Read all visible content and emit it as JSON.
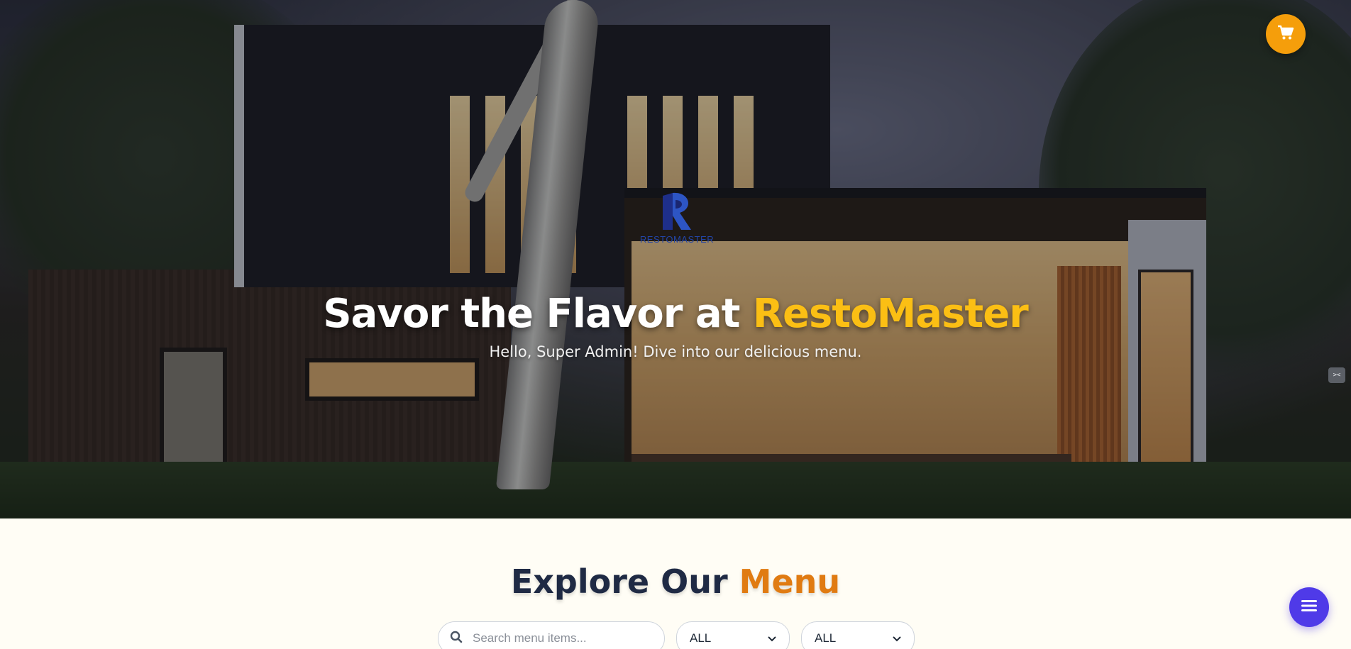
{
  "brand": {
    "logo_text": "RESTOMASTER"
  },
  "hero": {
    "title_prefix": "Savor the Flavor at ",
    "title_accent": "RestoMaster",
    "subtitle": "Hello, Super Admin! Dive into our delicious menu."
  },
  "menu": {
    "title_prefix": "Explore Our ",
    "title_accent": "Menu",
    "search_placeholder": "Search menu items...",
    "filter_one_value": "ALL",
    "filter_two_value": "ALL"
  },
  "icons": {
    "cart": "cart-icon",
    "search": "search-icon",
    "menu": "hamburger-icon",
    "side_handle": "code-icon"
  },
  "colors": {
    "accent_yellow": "#fbbf14",
    "accent_orange": "#e07b12",
    "cart_button": "#f59e0b",
    "fab_button": "#4f3ae8",
    "heading_dark": "#1f2a44"
  }
}
